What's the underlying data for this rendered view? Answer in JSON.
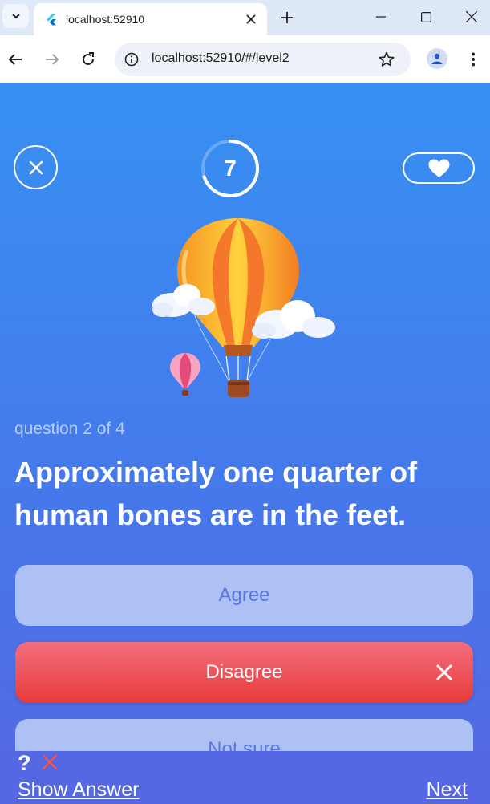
{
  "browser": {
    "tab_title": "localhost:52910",
    "url": "localhost:52910/#/level2",
    "icons": {
      "tab_search": "chevron-down-icon",
      "favicon": "flutter-icon",
      "tab_close": "close-icon",
      "new_tab": "plus-icon",
      "minimize": "minimize-icon",
      "maximize": "maximize-icon",
      "window_close": "close-icon",
      "back": "arrow-left-icon",
      "forward": "arrow-right-icon",
      "reload": "reload-icon",
      "site_info": "info-icon",
      "bookmark": "star-icon",
      "profile": "person-icon",
      "menu": "more-vert-icon"
    }
  },
  "quiz": {
    "timer": "7",
    "timer_progress": 0.7,
    "question_counter": "question 2 of 4",
    "question_text": "Approximately one quarter of human bones are in the feet.",
    "answers": [
      {
        "label": "Agree",
        "state": "unselected"
      },
      {
        "label": "Disagree",
        "state": "selected-wrong"
      },
      {
        "label": "Not sure",
        "state": "unselected"
      }
    ],
    "hint_symbol": "?",
    "show_answer_label": "Show Answer",
    "next_label": "Next",
    "icons": {
      "close": "close-icon",
      "lives": "heart-icon",
      "illustration": "hot-air-balloon-illustration",
      "wrong_mark": "close-icon",
      "hint_status": "close-icon"
    }
  },
  "colors": {
    "background_top": "#3790f2",
    "background_bottom": "#5568e3",
    "answer_default": "#adc1f4",
    "answer_text": "#5977e4",
    "answer_wrong": "#e83a3a",
    "hint_x": "#ef5350"
  }
}
